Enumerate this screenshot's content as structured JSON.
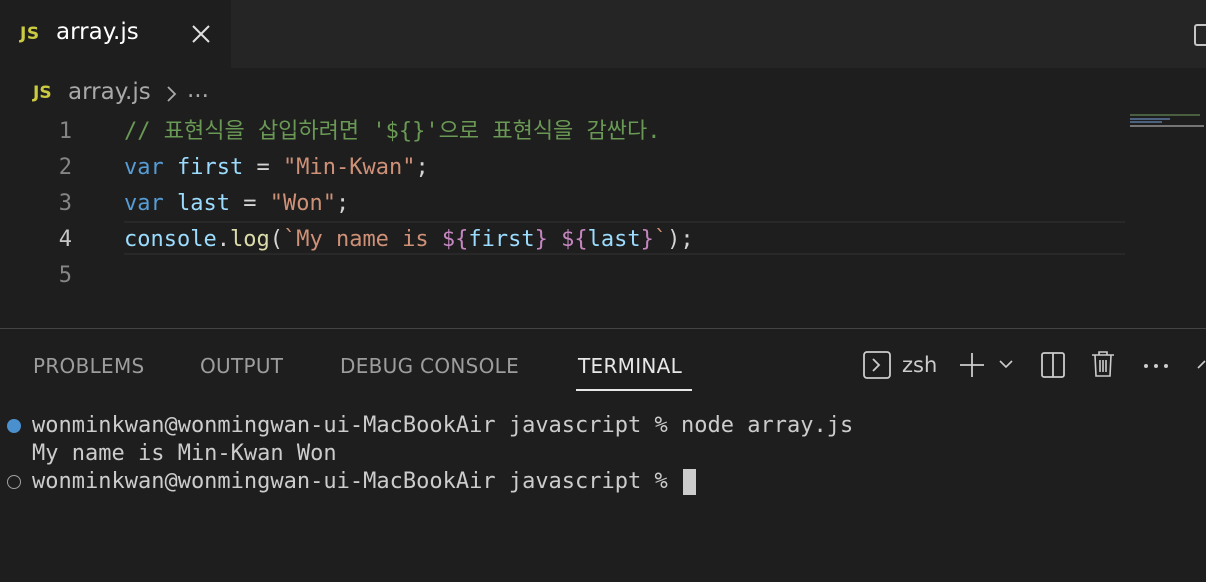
{
  "tab": {
    "badge": "JS",
    "label": "array.js"
  },
  "breadcrumb": {
    "badge": "JS",
    "file": "array.js",
    "more": "..."
  },
  "editor": {
    "lines": [
      {
        "number": "1",
        "parts": [
          {
            "t": "// 표현식을 삽입하려면 '${}'으로 표현식을 감싼다.",
            "c": "c-comment"
          }
        ]
      },
      {
        "number": "2",
        "parts": [
          {
            "t": "var",
            "c": "c-kw"
          },
          {
            "t": " ",
            "c": "c-punc"
          },
          {
            "t": "first",
            "c": "c-var"
          },
          {
            "t": " = ",
            "c": "c-punc"
          },
          {
            "t": "\"Min-Kwan\"",
            "c": "c-str"
          },
          {
            "t": ";",
            "c": "c-punc"
          }
        ]
      },
      {
        "number": "3",
        "parts": [
          {
            "t": "var",
            "c": "c-kw"
          },
          {
            "t": " ",
            "c": "c-punc"
          },
          {
            "t": "last",
            "c": "c-var"
          },
          {
            "t": " = ",
            "c": "c-punc"
          },
          {
            "t": "\"Won\"",
            "c": "c-str"
          },
          {
            "t": ";",
            "c": "c-punc"
          }
        ]
      },
      {
        "number": "4",
        "parts": [
          {
            "t": "console",
            "c": "c-var"
          },
          {
            "t": ".",
            "c": "c-punc"
          },
          {
            "t": "log",
            "c": "c-fn"
          },
          {
            "t": "(",
            "c": "c-punc"
          },
          {
            "t": "`My name is ",
            "c": "c-str"
          },
          {
            "t": "${",
            "c": "c-tmpl"
          },
          {
            "t": "first",
            "c": "c-var"
          },
          {
            "t": "}",
            "c": "c-tmpl"
          },
          {
            "t": " ",
            "c": "c-str"
          },
          {
            "t": "${",
            "c": "c-tmpl"
          },
          {
            "t": "last",
            "c": "c-var"
          },
          {
            "t": "}",
            "c": "c-tmpl"
          },
          {
            "t": "`",
            "c": "c-str"
          },
          {
            "t": ");",
            "c": "c-punc"
          }
        ]
      },
      {
        "number": "5",
        "parts": []
      }
    ],
    "active_line": "4"
  },
  "panel": {
    "tabs": [
      "PROBLEMS",
      "OUTPUT",
      "DEBUG CONSOLE",
      "TERMINAL"
    ],
    "active_tab": "TERMINAL",
    "shell": "zsh"
  },
  "terminal": {
    "lines": [
      "wonminkwan@wonmingwan-ui-MacBookAir javascript % node array.js",
      "My name is Min-Kwan Won",
      "wonminkwan@wonmingwan-ui-MacBookAir javascript % "
    ]
  },
  "colors": {
    "background": "#1e1e1e",
    "tab_bar": "#252526",
    "js_badge": "#cbcb41",
    "comment": "#6a9955",
    "keyword": "#569cd6",
    "variable": "#9cdcfe",
    "string": "#ce9178",
    "function": "#dcdcaa",
    "template": "#c586c0",
    "success_dot": "#4a8fce"
  }
}
